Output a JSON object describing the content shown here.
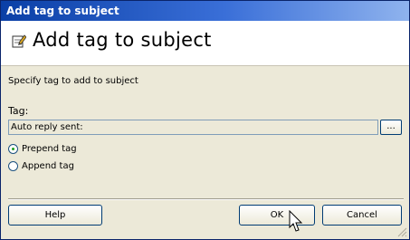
{
  "window": {
    "title": "Add tag to subject"
  },
  "header": {
    "title": "Add tag to subject",
    "icon": "edit-page-icon"
  },
  "form": {
    "description": "Specify tag to add to subject",
    "tag_label": "Tag:",
    "tag_value": "Auto reply sent:",
    "browse_label": "...",
    "radios": [
      {
        "label": "Prepend tag",
        "checked": true
      },
      {
        "label": "Append tag",
        "checked": false
      }
    ]
  },
  "buttons": {
    "help": "Help",
    "ok": "OK",
    "cancel": "Cancel"
  },
  "colors": {
    "titlebar": "#0a3fa6",
    "dialog_bg": "#ece9d8",
    "header_bg": "#ffffff"
  }
}
